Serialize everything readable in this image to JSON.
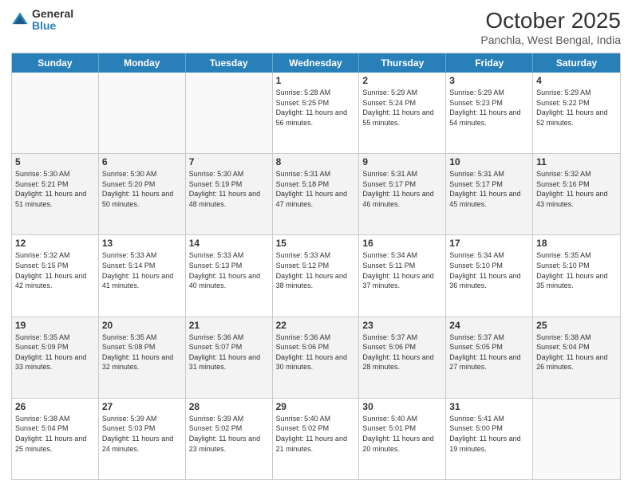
{
  "header": {
    "logo_general": "General",
    "logo_blue": "Blue",
    "month_title": "October 2025",
    "subtitle": "Panchla, West Bengal, India"
  },
  "days_of_week": [
    "Sunday",
    "Monday",
    "Tuesday",
    "Wednesday",
    "Thursday",
    "Friday",
    "Saturday"
  ],
  "weeks": [
    [
      {
        "day": "",
        "empty": true
      },
      {
        "day": "",
        "empty": true
      },
      {
        "day": "",
        "empty": true
      },
      {
        "day": "1",
        "sunrise": "5:28 AM",
        "sunset": "5:25 PM",
        "daylight": "11 hours and 56 minutes."
      },
      {
        "day": "2",
        "sunrise": "5:29 AM",
        "sunset": "5:24 PM",
        "daylight": "11 hours and 55 minutes."
      },
      {
        "day": "3",
        "sunrise": "5:29 AM",
        "sunset": "5:23 PM",
        "daylight": "11 hours and 54 minutes."
      },
      {
        "day": "4",
        "sunrise": "5:29 AM",
        "sunset": "5:22 PM",
        "daylight": "11 hours and 52 minutes."
      }
    ],
    [
      {
        "day": "5",
        "sunrise": "5:30 AM",
        "sunset": "5:21 PM",
        "daylight": "11 hours and 51 minutes."
      },
      {
        "day": "6",
        "sunrise": "5:30 AM",
        "sunset": "5:20 PM",
        "daylight": "11 hours and 50 minutes."
      },
      {
        "day": "7",
        "sunrise": "5:30 AM",
        "sunset": "5:19 PM",
        "daylight": "11 hours and 48 minutes."
      },
      {
        "day": "8",
        "sunrise": "5:31 AM",
        "sunset": "5:18 PM",
        "daylight": "11 hours and 47 minutes."
      },
      {
        "day": "9",
        "sunrise": "5:31 AM",
        "sunset": "5:17 PM",
        "daylight": "11 hours and 46 minutes."
      },
      {
        "day": "10",
        "sunrise": "5:31 AM",
        "sunset": "5:17 PM",
        "daylight": "11 hours and 45 minutes."
      },
      {
        "day": "11",
        "sunrise": "5:32 AM",
        "sunset": "5:16 PM",
        "daylight": "11 hours and 43 minutes."
      }
    ],
    [
      {
        "day": "12",
        "sunrise": "5:32 AM",
        "sunset": "5:15 PM",
        "daylight": "11 hours and 42 minutes."
      },
      {
        "day": "13",
        "sunrise": "5:33 AM",
        "sunset": "5:14 PM",
        "daylight": "11 hours and 41 minutes."
      },
      {
        "day": "14",
        "sunrise": "5:33 AM",
        "sunset": "5:13 PM",
        "daylight": "11 hours and 40 minutes."
      },
      {
        "day": "15",
        "sunrise": "5:33 AM",
        "sunset": "5:12 PM",
        "daylight": "11 hours and 38 minutes."
      },
      {
        "day": "16",
        "sunrise": "5:34 AM",
        "sunset": "5:11 PM",
        "daylight": "11 hours and 37 minutes."
      },
      {
        "day": "17",
        "sunrise": "5:34 AM",
        "sunset": "5:10 PM",
        "daylight": "11 hours and 36 minutes."
      },
      {
        "day": "18",
        "sunrise": "5:35 AM",
        "sunset": "5:10 PM",
        "daylight": "11 hours and 35 minutes."
      }
    ],
    [
      {
        "day": "19",
        "sunrise": "5:35 AM",
        "sunset": "5:09 PM",
        "daylight": "11 hours and 33 minutes."
      },
      {
        "day": "20",
        "sunrise": "5:35 AM",
        "sunset": "5:08 PM",
        "daylight": "11 hours and 32 minutes."
      },
      {
        "day": "21",
        "sunrise": "5:36 AM",
        "sunset": "5:07 PM",
        "daylight": "11 hours and 31 minutes."
      },
      {
        "day": "22",
        "sunrise": "5:36 AM",
        "sunset": "5:06 PM",
        "daylight": "11 hours and 30 minutes."
      },
      {
        "day": "23",
        "sunrise": "5:37 AM",
        "sunset": "5:06 PM",
        "daylight": "11 hours and 28 minutes."
      },
      {
        "day": "24",
        "sunrise": "5:37 AM",
        "sunset": "5:05 PM",
        "daylight": "11 hours and 27 minutes."
      },
      {
        "day": "25",
        "sunrise": "5:38 AM",
        "sunset": "5:04 PM",
        "daylight": "11 hours and 26 minutes."
      }
    ],
    [
      {
        "day": "26",
        "sunrise": "5:38 AM",
        "sunset": "5:04 PM",
        "daylight": "11 hours and 25 minutes."
      },
      {
        "day": "27",
        "sunrise": "5:39 AM",
        "sunset": "5:03 PM",
        "daylight": "11 hours and 24 minutes."
      },
      {
        "day": "28",
        "sunrise": "5:39 AM",
        "sunset": "5:02 PM",
        "daylight": "11 hours and 23 minutes."
      },
      {
        "day": "29",
        "sunrise": "5:40 AM",
        "sunset": "5:02 PM",
        "daylight": "11 hours and 21 minutes."
      },
      {
        "day": "30",
        "sunrise": "5:40 AM",
        "sunset": "5:01 PM",
        "daylight": "11 hours and 20 minutes."
      },
      {
        "day": "31",
        "sunrise": "5:41 AM",
        "sunset": "5:00 PM",
        "daylight": "11 hours and 19 minutes."
      },
      {
        "day": "",
        "empty": true
      }
    ]
  ]
}
